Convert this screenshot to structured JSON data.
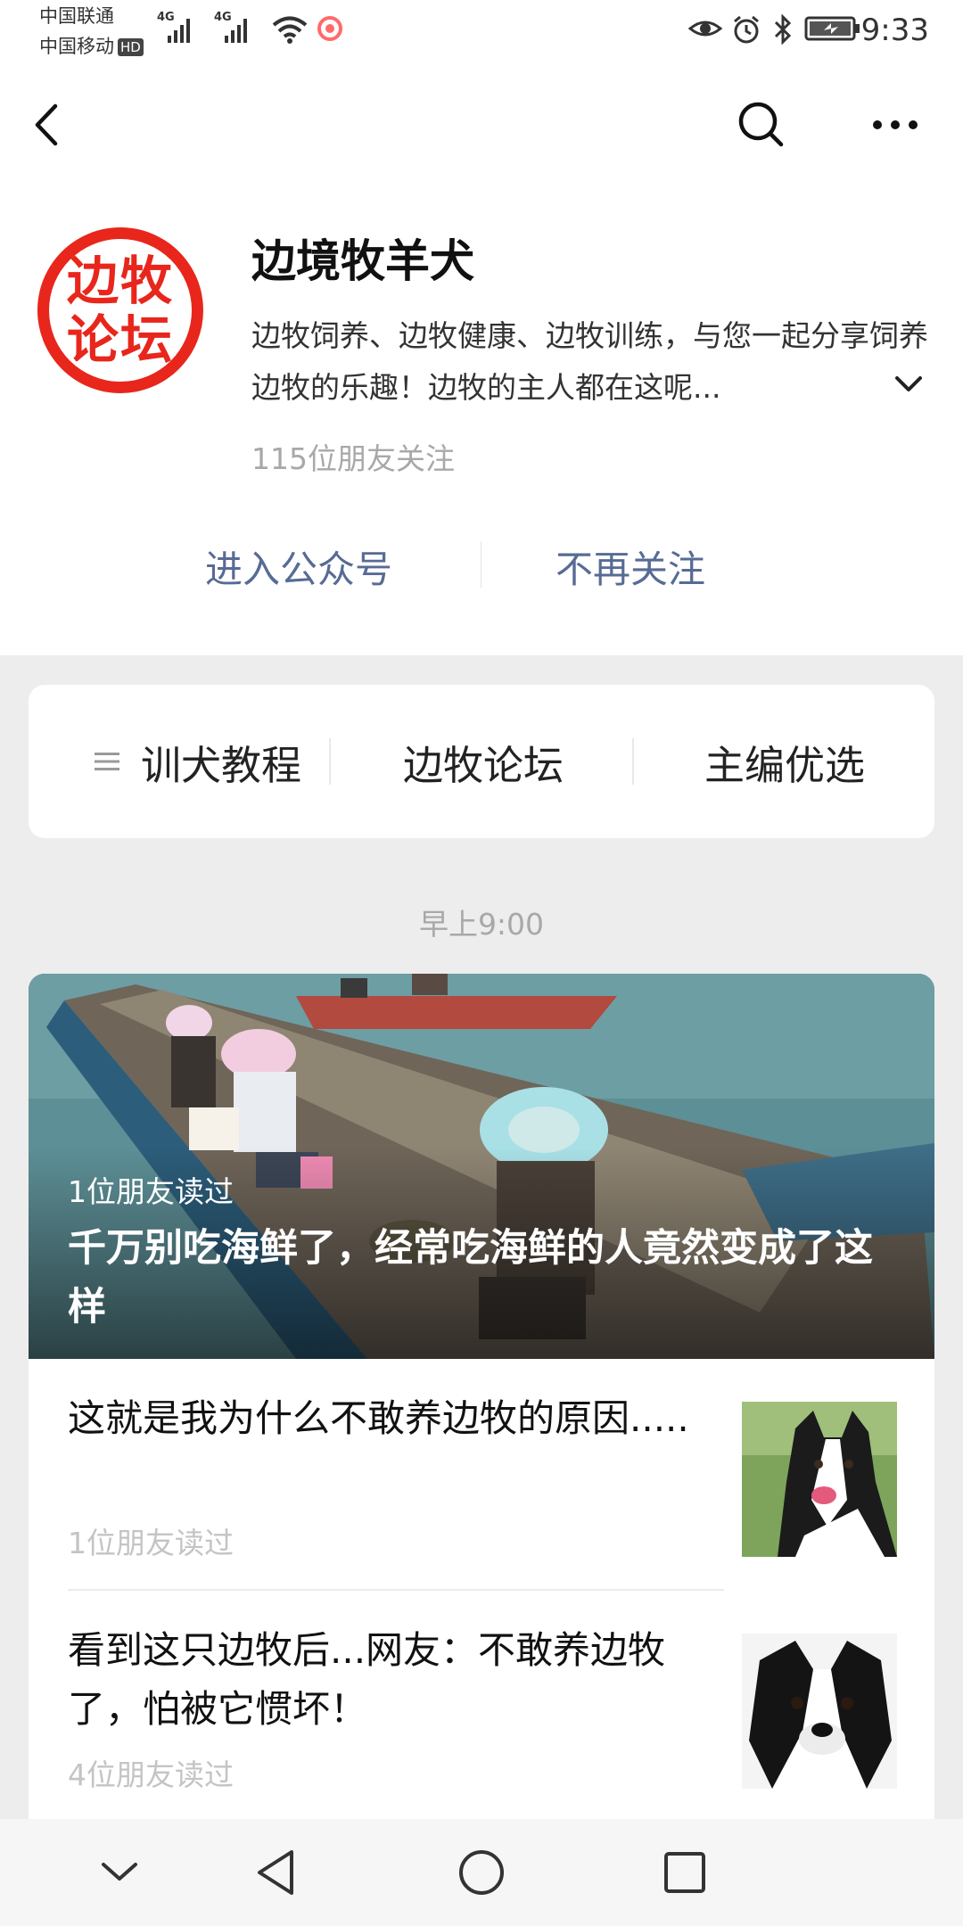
{
  "status_bar": {
    "carrier_1": "中国联通",
    "carrier_2": "中国移动",
    "hd_badge": "HD",
    "signal_1_label": "4G",
    "signal_2_label": "4G",
    "time": "9:33"
  },
  "account": {
    "logo_text_line1": "边牧",
    "logo_text_line2": "论坛",
    "name": "边境牧羊犬",
    "description": "边牧饲养、边牧健康、边牧训练，与您一起分享饲养边牧的乐趣！边牧的主人都在这呢...",
    "followers": "115位朋友关注",
    "enter_label": "进入公众号",
    "unfollow_label": "不再关注"
  },
  "menu": {
    "items": [
      {
        "label": "训犬教程"
      },
      {
        "label": "边牧论坛"
      },
      {
        "label": "主编优选"
      }
    ]
  },
  "feed": {
    "timestamp": "早上9:00",
    "hero": {
      "readers": "1位朋友读过",
      "title": "千万别吃海鲜了，经常吃海鲜的人竟然变成了这样"
    },
    "articles": [
      {
        "title": "这就是我为什么不敢养边牧的原因.....",
        "readers": "1位朋友读过"
      },
      {
        "title": "看到这只边牧后...网友：不敢养边牧了，怕被它惯坏！",
        "readers": "4位朋友读过"
      }
    ]
  },
  "colors": {
    "link": "#576b95",
    "brand_red": "#e8261c",
    "muted": "#a8a8a8"
  },
  "icons": {
    "back": "back-chevron-icon",
    "search": "search-icon",
    "more": "more-dots-icon",
    "expand": "chevron-down-icon",
    "menu": "menu-lines-icon",
    "nav_hide": "nav-hide-icon",
    "nav_back": "nav-back-icon",
    "nav_home": "nav-home-icon",
    "nav_recents": "nav-recents-icon"
  }
}
